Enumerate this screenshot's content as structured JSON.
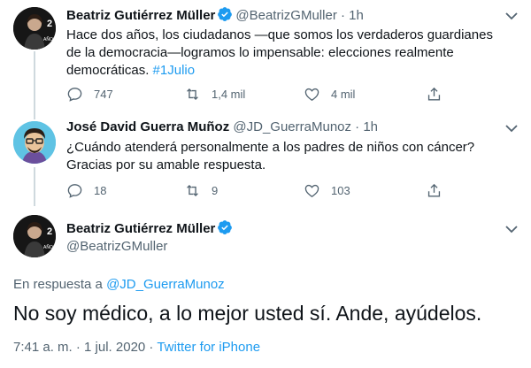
{
  "colors": {
    "accent": "#1d9bf0",
    "muted": "#536471",
    "verified": "#1d9bf0"
  },
  "tweet1": {
    "name": "Beatriz Gutiérrez Müller",
    "handle": "@BeatrizGMuller",
    "separator": "·",
    "time": "1h",
    "text_main": "Hace dos años, los ciudadanos —que somos los verdaderos guardianes de la democracia—logramos lo impensable: elecciones realmente democráticas.",
    "hashtag": "#1Julio",
    "replies": "747",
    "retweets": "1,4 mil",
    "likes": "4 mil"
  },
  "tweet2": {
    "name": "José David Guerra Muñoz",
    "handle": "@JD_GuerraMunoz",
    "separator": "·",
    "time": "1h",
    "text": "¿Cuándo atenderá personalmente a los padres de niños con cáncer? Gracias por su amable respuesta.",
    "replies": "18",
    "retweets": "9",
    "likes": "103"
  },
  "main_tweet": {
    "name": "Beatriz Gutiérrez Müller",
    "handle": "@BeatrizGMuller",
    "reply_prefix": "En respuesta a",
    "reply_mention": "@JD_GuerraMunoz",
    "text": "No soy médico, a lo mejor usted sí. Ande, ayúdelos.",
    "timestamp": "7:41 a. m. · 1 jul. 2020 ·",
    "source": "Twitter for iPhone"
  }
}
